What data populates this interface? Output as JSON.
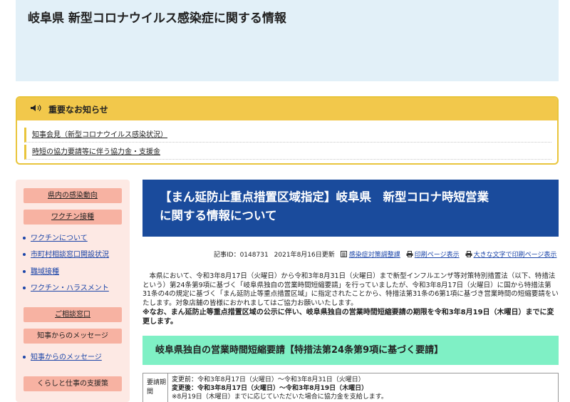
{
  "header": {
    "title": "岐阜県 新型コロナウイルス感染症に関する情報"
  },
  "notice": {
    "heading": "重要なお知らせ",
    "items": [
      {
        "label": "知事会見（新型コロナウイルス感染状況）"
      },
      {
        "label": "時短の協力要請等に伴う協力金・支援金"
      }
    ]
  },
  "sidebar": {
    "btn1": "県内の感染動向",
    "btn2": "ワクチン接種",
    "links1": [
      "ワクチンについて",
      "市町村相談窓口開設状況",
      "職域接種",
      "ワクチン・ハラスメント"
    ],
    "btn3": "ご相談窓口",
    "btn4": "知事からのメッセージ",
    "links2": [
      "知事からのメッセージ"
    ],
    "btn5": "くらしと仕事の支援策"
  },
  "main": {
    "title_line1": "【まん延防止重点措置区域指定】岐阜県　新型コロナ時短営業",
    "title_line2": "に関する情報について",
    "meta": {
      "article_id": "記事ID：0148731",
      "date": "2021年8月16日更新",
      "dept": "感染症対策調整課",
      "print": "印刷ページ表示",
      "print_large": "大きな文字で印刷ページ表示"
    },
    "paragraph": "　本県において、令和3年8月17日（火曜日）から令和3年8月31日（火曜日）まで新型インフルエンザ等対策特別措置法（以下、特措法という）第24条第9項に基づく「岐阜県独自の営業時間短縮要請」を行っていましたが、令和3年8月17日（火曜日）に国から特措法第31条の4の規定に基づく「まん延防止等重点措置区域」に指定されたことから、特措法第31条の6第1項に基づき営業時間の短縮要請をいたします。対象店舗の皆様におかれましてはご協力お願いいたします。",
    "notice_bold": "※なお、まん延防止等重点措置区域の公示に伴い、岐阜県独自の営業時間短縮要請の期限を令和3年8月19日（木曜日）までに変更します。",
    "section_heading": "岐阜県独自の営業時間短縮要請【特措法第24条第9項に基づく要請】",
    "table": {
      "header": "要請期間",
      "line1": "変更前：令和3年8月17日（火曜日）～令和3年8月31日（火曜日）",
      "line2": "変更後：令和3年8月17日（火曜日）～令和3年8月19日（木曜日）",
      "line3": "※8月19日（木曜日）までに応じていただいた場合に協力金を支給します。"
    }
  }
}
